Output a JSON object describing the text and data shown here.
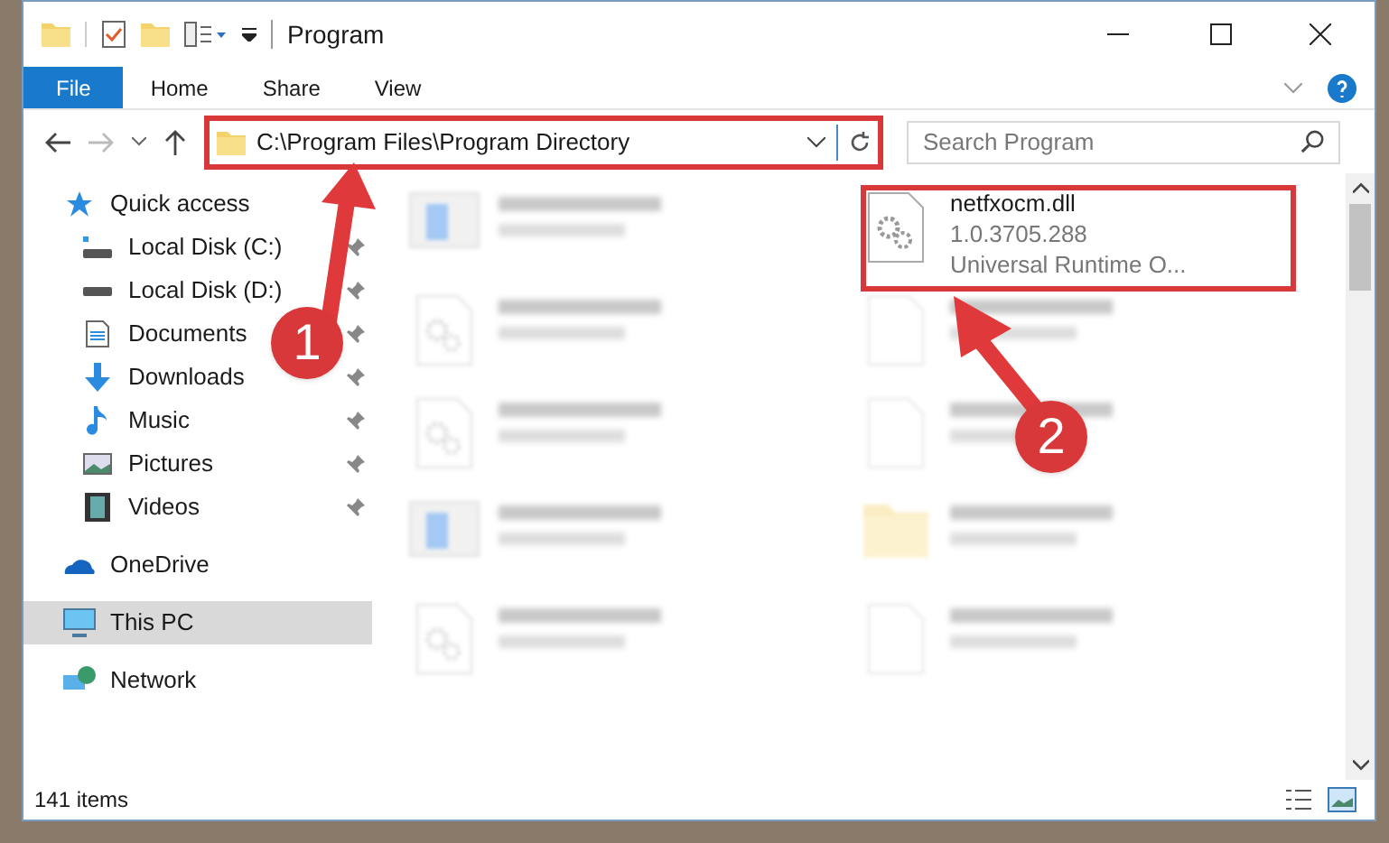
{
  "window": {
    "title": "Program"
  },
  "ribbon_tabs": [
    {
      "label": "File",
      "selected": true
    },
    {
      "label": "Home",
      "selected": false
    },
    {
      "label": "Share",
      "selected": false
    },
    {
      "label": "View",
      "selected": false
    }
  ],
  "address": {
    "path": "C:\\Program Files\\Program Directory"
  },
  "search": {
    "placeholder": "Search Program"
  },
  "sidebar": {
    "items": [
      {
        "label": "Quick access",
        "kind": "group",
        "pinned": false,
        "selected": false
      },
      {
        "label": "Local Disk (C:)",
        "kind": "item",
        "pinned": true,
        "selected": false
      },
      {
        "label": "Local Disk (D:)",
        "kind": "item",
        "pinned": true,
        "selected": false
      },
      {
        "label": "Documents",
        "kind": "item",
        "pinned": true,
        "selected": false
      },
      {
        "label": "Downloads",
        "kind": "item",
        "pinned": true,
        "selected": false
      },
      {
        "label": "Music",
        "kind": "item",
        "pinned": true,
        "selected": false
      },
      {
        "label": "Pictures",
        "kind": "item",
        "pinned": true,
        "selected": false
      },
      {
        "label": "Videos",
        "kind": "item",
        "pinned": true,
        "selected": false
      },
      {
        "label": "OneDrive",
        "kind": "group",
        "pinned": false,
        "selected": false
      },
      {
        "label": "This PC",
        "kind": "group",
        "pinned": false,
        "selected": true
      },
      {
        "label": "Network",
        "kind": "group",
        "pinned": false,
        "selected": false
      }
    ]
  },
  "files": [
    {
      "kind": "application",
      "blurred": true
    },
    {
      "kind": "library",
      "blurred": false,
      "name": "netfxocm.dll",
      "details": [
        "1.0.3705.288",
        "Universal Runtime O..."
      ]
    },
    {
      "kind": "library",
      "blurred": true
    },
    {
      "kind": "document",
      "blurred": true
    },
    {
      "kind": "library",
      "blurred": true
    },
    {
      "kind": "document",
      "blurred": true
    },
    {
      "kind": "application",
      "blurred": true
    },
    {
      "kind": "folder",
      "blurred": true
    },
    {
      "kind": "library",
      "blurred": true
    },
    {
      "kind": "document",
      "blurred": true
    }
  ],
  "status_bar": {
    "count": "141 items"
  },
  "annotations": [
    {
      "label": "1"
    },
    {
      "label": "2"
    }
  ]
}
